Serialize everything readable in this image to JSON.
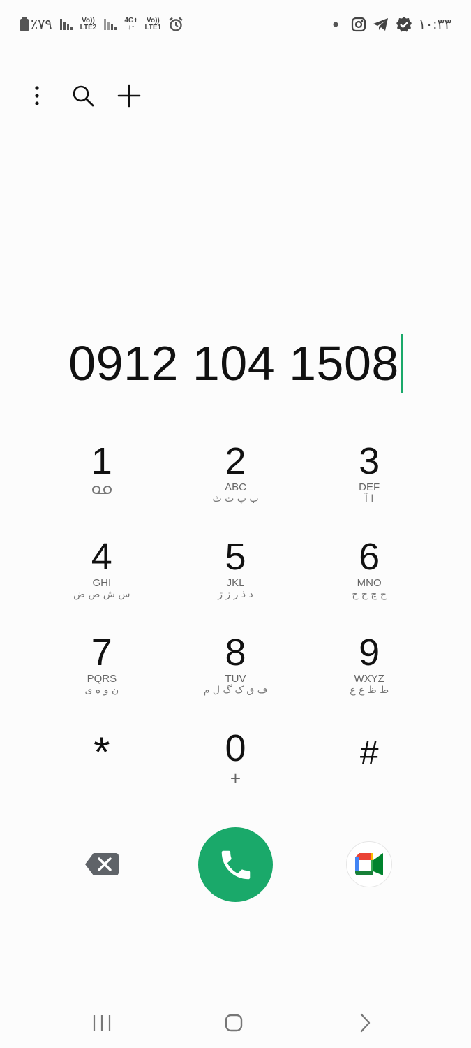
{
  "status_bar": {
    "battery_percent": "٪۷۹",
    "sim2_label_top": "Vo))",
    "sim2_label_bottom": "LTE2",
    "sim1_label_top": "4G+",
    "sim1_label_mid": "Vo))",
    "sim1_label_bottom": "LTE1",
    "time": "۱۰:۳۳",
    "icons": [
      "battery-icon",
      "signal-icon",
      "alarm-icon",
      "dot-icon",
      "instagram-icon",
      "telegram-icon",
      "verified-icon"
    ]
  },
  "top_actions": [
    "more-options-icon",
    "search-icon",
    "add-contact-icon"
  ],
  "dialed_number": "0912 104 1508",
  "keypad": [
    {
      "digit": "1",
      "latin": "",
      "persian": "",
      "sub_icon": "voicemail-icon"
    },
    {
      "digit": "2",
      "latin": "ABC",
      "persian": "ب پ ت ث",
      "sub_icon": ""
    },
    {
      "digit": "3",
      "latin": "DEF",
      "persian": "ا آ",
      "sub_icon": ""
    },
    {
      "digit": "4",
      "latin": "GHI",
      "persian": "س ش ص ض",
      "sub_icon": ""
    },
    {
      "digit": "5",
      "latin": "JKL",
      "persian": "د ذ ر ز ژ",
      "sub_icon": ""
    },
    {
      "digit": "6",
      "latin": "MNO",
      "persian": "ج چ ح خ",
      "sub_icon": ""
    },
    {
      "digit": "7",
      "latin": "PQRS",
      "persian": "ن و ه ی",
      "sub_icon": ""
    },
    {
      "digit": "8",
      "latin": "TUV",
      "persian": "ف ق ک گ ل م",
      "sub_icon": ""
    },
    {
      "digit": "9",
      "latin": "WXYZ",
      "persian": "ط ظ ع غ",
      "sub_icon": ""
    },
    {
      "digit": "*",
      "latin": "",
      "persian": "",
      "sub_icon": ""
    },
    {
      "digit": "0",
      "latin": "",
      "persian": "",
      "sub_text": "+"
    },
    {
      "digit": "#",
      "latin": "",
      "persian": "",
      "sub_icon": ""
    }
  ],
  "bottom_actions": {
    "backspace": "backspace-icon",
    "call": "phone-icon",
    "video": "google-meet-icon"
  },
  "colors": {
    "call_green": "#1aa96a",
    "caret": "#1aa96a",
    "background": "#fcfcfc"
  },
  "nav": [
    "recent-apps-icon",
    "home-icon",
    "back-icon"
  ]
}
